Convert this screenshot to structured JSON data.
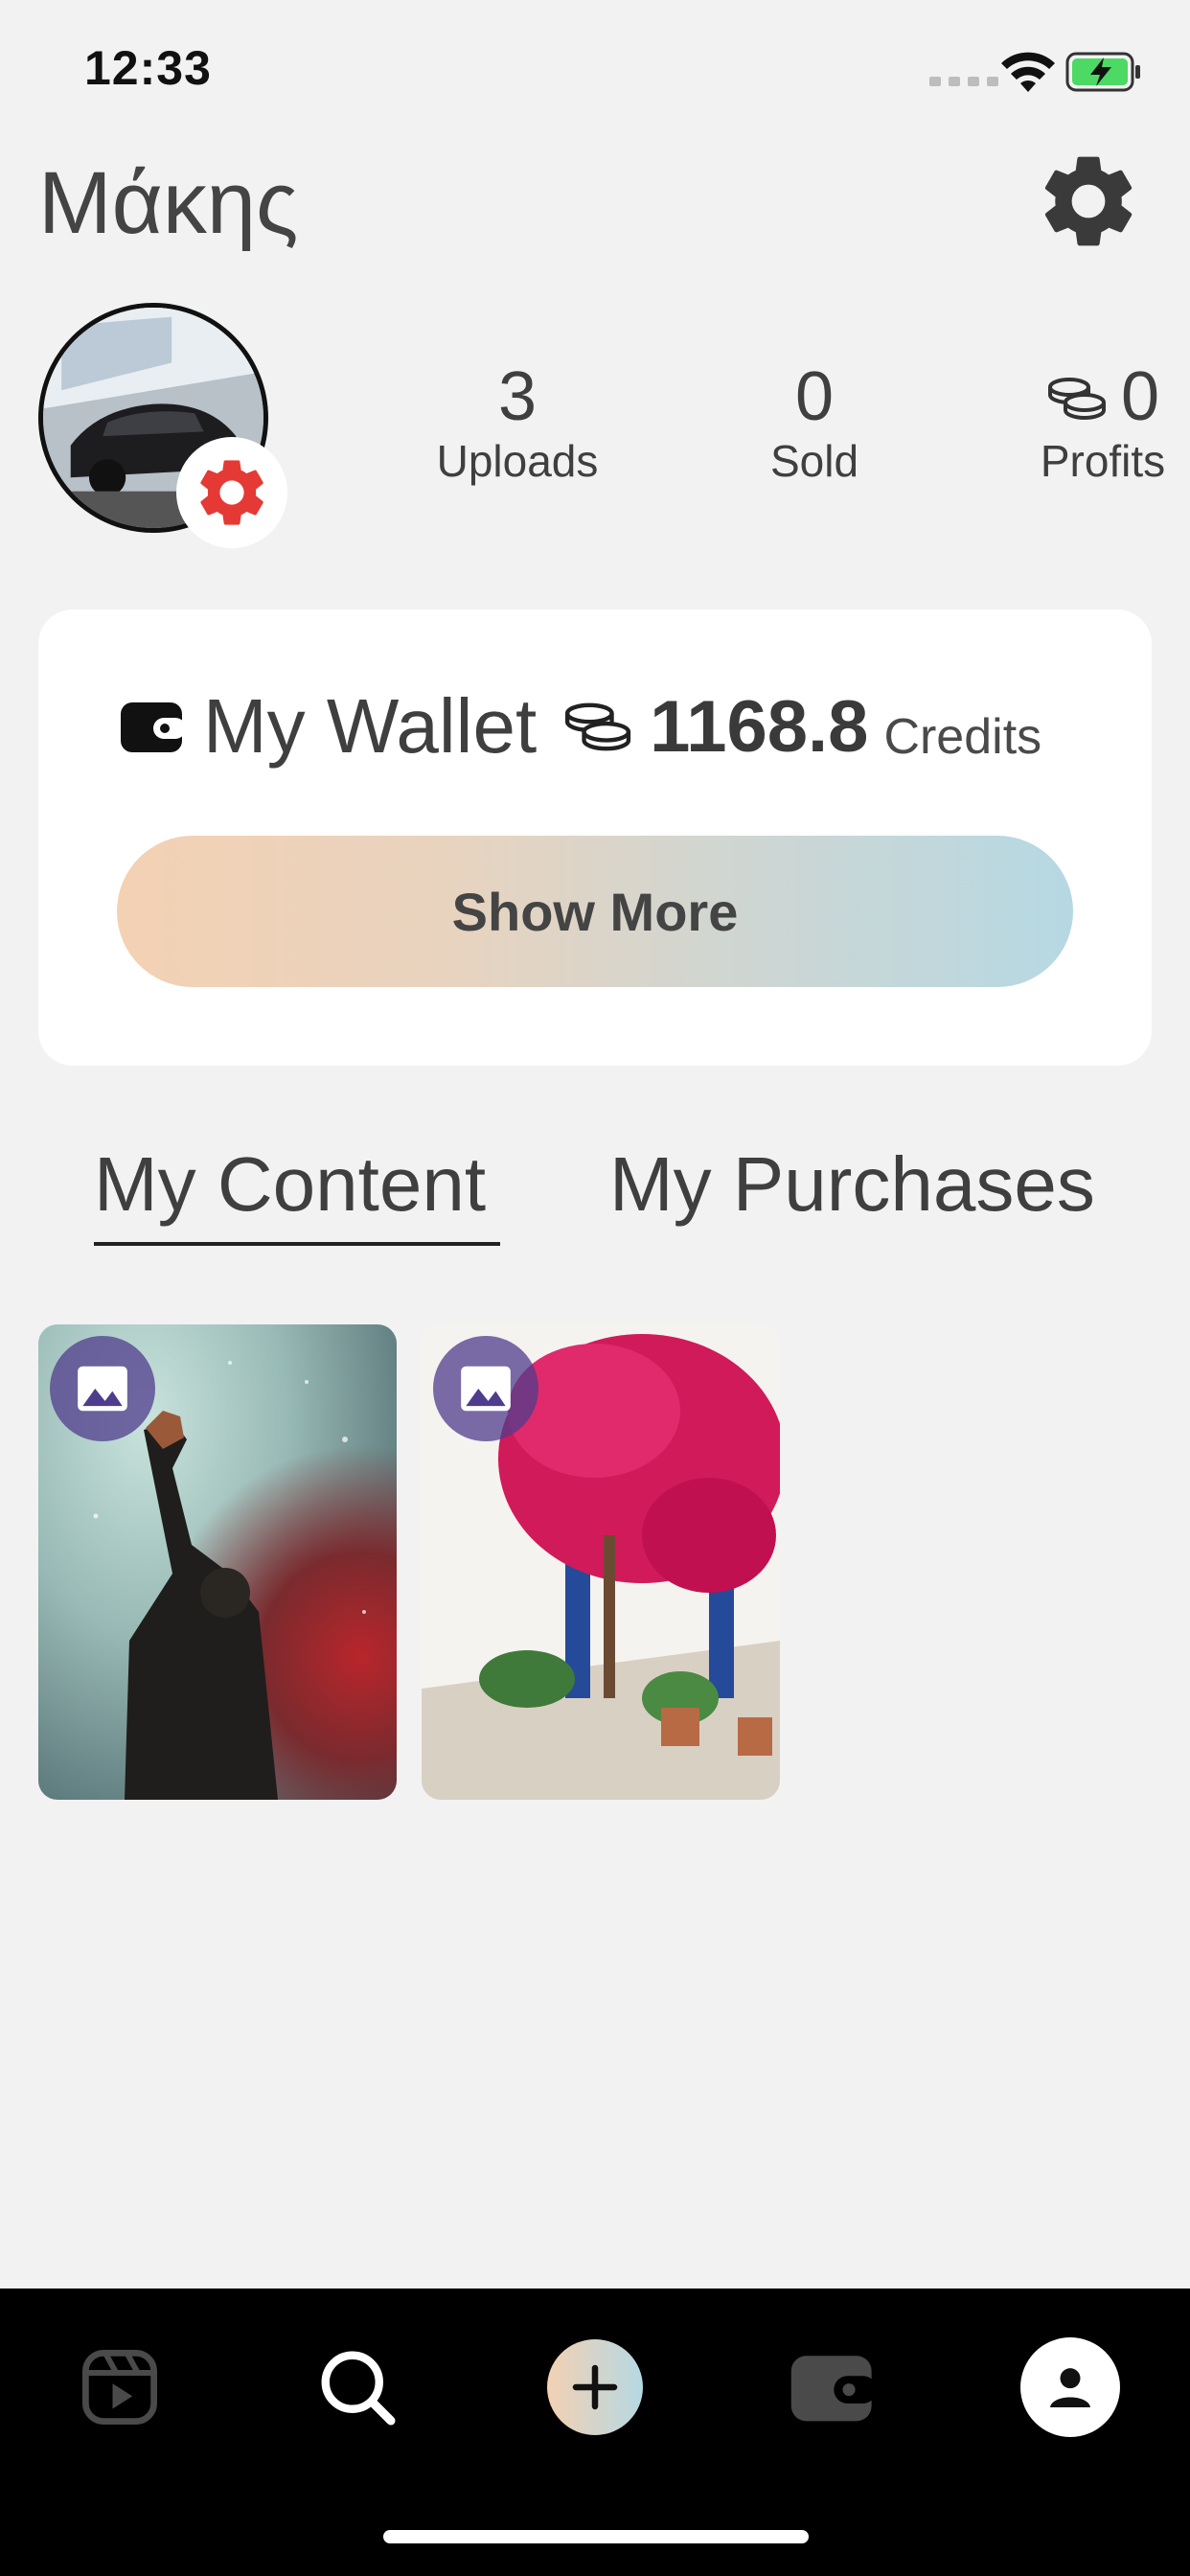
{
  "status_bar": {
    "time": "12:33"
  },
  "header": {
    "user_name": "Μάκης"
  },
  "stats": [
    {
      "value": "3",
      "label": "Uploads"
    },
    {
      "value": "0",
      "label": "Sold"
    },
    {
      "value": "0",
      "label": "Profits"
    }
  ],
  "wallet": {
    "title": "My Wallet",
    "amount": "1168.8",
    "unit": "Credits",
    "show_more_label": "Show More"
  },
  "tabs": [
    {
      "label": "My Content",
      "active": true
    },
    {
      "label": "My Purchases",
      "active": false
    }
  ],
  "content_items": [
    {
      "type": "image",
      "icon": "image-icon"
    },
    {
      "type": "image",
      "icon": "image-icon"
    }
  ],
  "bottom_nav": [
    {
      "icon": "reels-icon"
    },
    {
      "icon": "search-icon"
    },
    {
      "icon": "add-icon"
    },
    {
      "icon": "wallet-icon"
    },
    {
      "icon": "profile-icon",
      "active": true
    }
  ],
  "colors": {
    "accent_badge": "#e53935",
    "wallet_gradient_start": "#f3d1b3",
    "wallet_gradient_end": "#b6d8e3",
    "thumb_badge": "#503c8c"
  }
}
